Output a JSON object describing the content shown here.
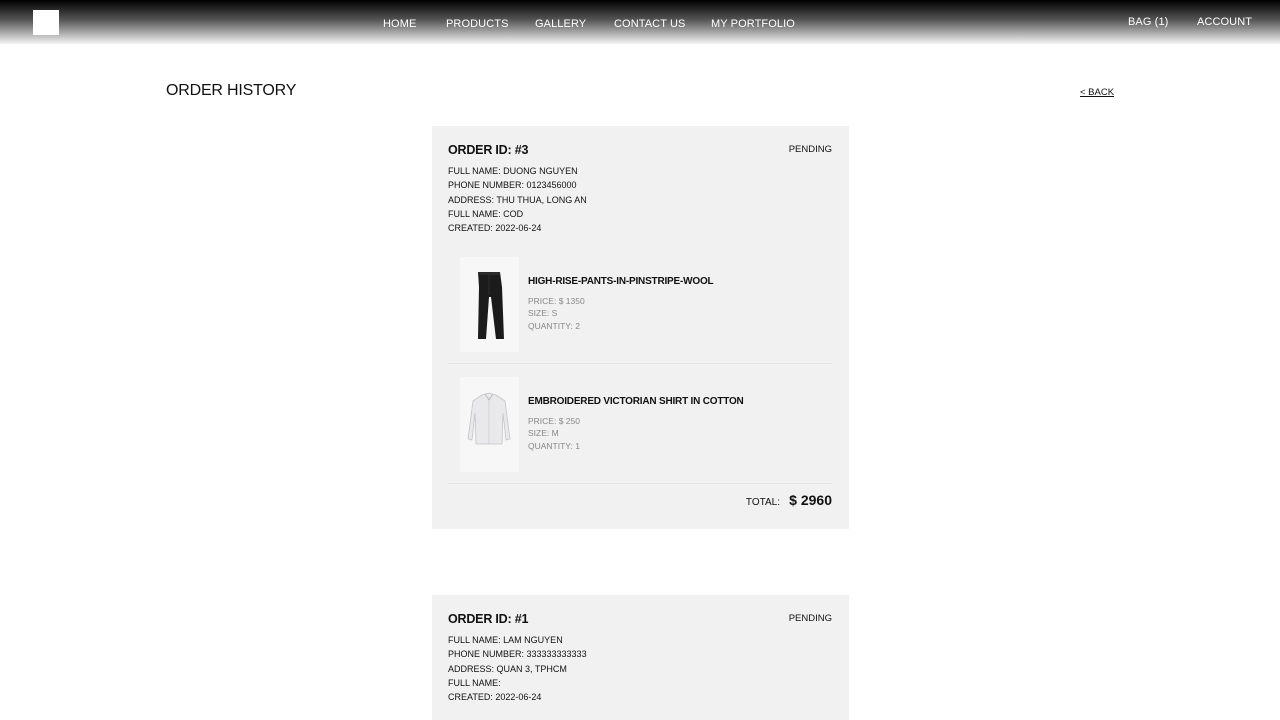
{
  "nav": {
    "home": "HOME",
    "products": "PRODUCTS",
    "gallery": "GALLERY",
    "contact": "CONTACT US",
    "portfolio": "MY PORTFOLIO",
    "bag": "BAG (1)",
    "account": "ACCOUNT"
  },
  "page": {
    "title": "ORDER HISTORY",
    "back": "< BACK"
  },
  "orders": [
    {
      "id": "ORDER ID: #3",
      "status": "PENDING",
      "full_name": "FULL NAME: DUONG NGUYEN",
      "phone": "PHONE NUMBER: 0123456000",
      "address": "ADDRESS: THU THUA, LONG AN",
      "payment": "FULL NAME: COD",
      "created": "CREATED: 2022-06-24",
      "items": [
        {
          "name": "HIGH-RISE-PANTS-IN-PINSTRIPE-WOOL",
          "price": "PRICE: $ 1350",
          "size": "SIZE:  S",
          "quantity": "QUANTITY:  2"
        },
        {
          "name": "EMBROIDERED VICTORIAN SHIRT IN COTTON",
          "price": "PRICE: $ 250",
          "size": "SIZE:  M",
          "quantity": "QUANTITY:  1"
        }
      ],
      "total_label": "TOTAL:",
      "total_value": "$ 2960"
    },
    {
      "id": "ORDER ID: #1",
      "status": "PENDING",
      "full_name": "FULL NAME: LAM NGUYEN",
      "phone": "PHONE NUMBER: 333333333333",
      "address": "ADDRESS: QUAN 3, TPHCM",
      "payment": "FULL NAME:",
      "created": "CREATED: 2022-06-24"
    }
  ]
}
